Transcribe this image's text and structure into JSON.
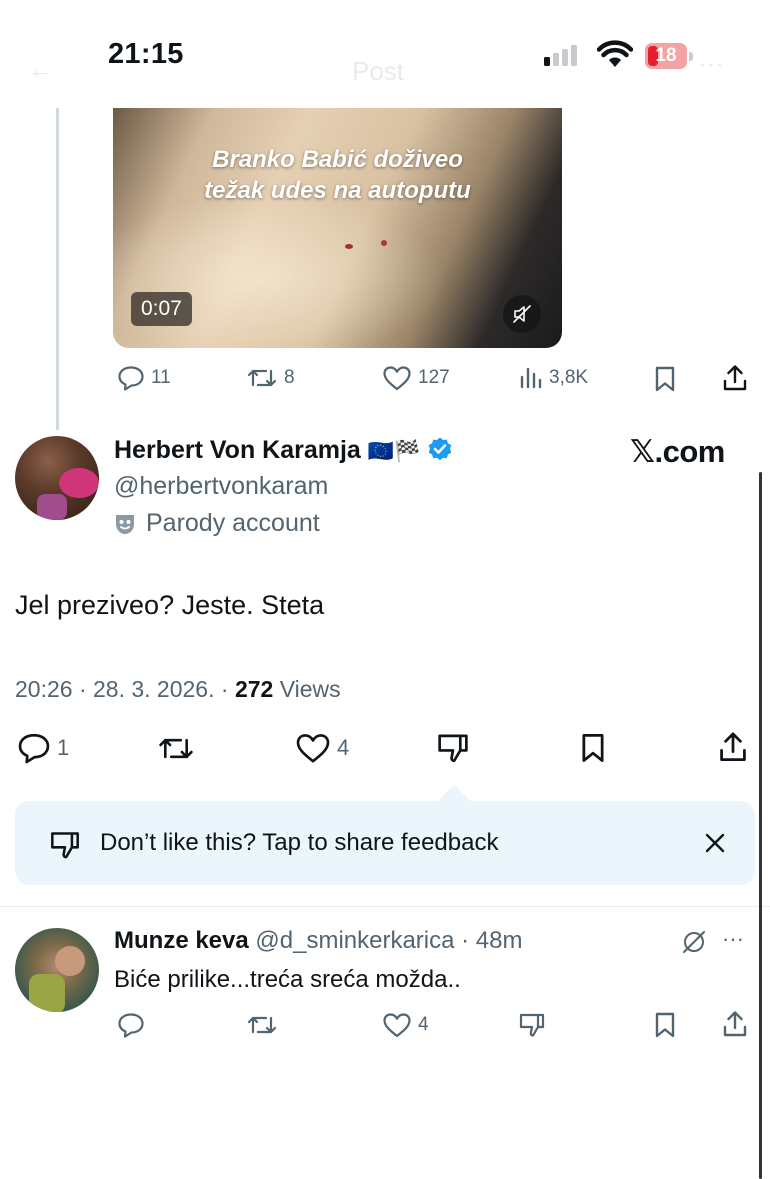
{
  "status_bar": {
    "time": "21:15",
    "battery": "18"
  },
  "background_header": {
    "title": "Post"
  },
  "video": {
    "caption_line1": "Branko Babić doživeo",
    "caption_line2": "težak udes na autoputu",
    "duration": "0:07"
  },
  "quoted_actions": {
    "replies": "11",
    "reposts": "8",
    "likes": "127",
    "views": "3,8K"
  },
  "tweet": {
    "author_name": "Herbert Von Karamja",
    "author_flags": "🇪🇺🏁",
    "handle": "@herbertvonkaram",
    "parody_label": "Parody account",
    "watermark": "𝕏.com",
    "text": "Jel preziveo? Jeste. Steta",
    "time": "20:26 · 28. 3. 2026. · ",
    "views_count": "272",
    "views_label": " Views",
    "replies": "1",
    "likes": "4"
  },
  "feedback": {
    "text": "Don’t like this? Tap to share feedback"
  },
  "reply": {
    "name": "Munze keva",
    "handle_time": " @d_sminkerkarica · 48m",
    "text": "Biće prilike...treća sreća možda..",
    "likes": "4"
  },
  "colors": {
    "accent": "#1d9bf0",
    "secondary_text": "#536471",
    "feedback_bg": "#eaf6fb"
  }
}
